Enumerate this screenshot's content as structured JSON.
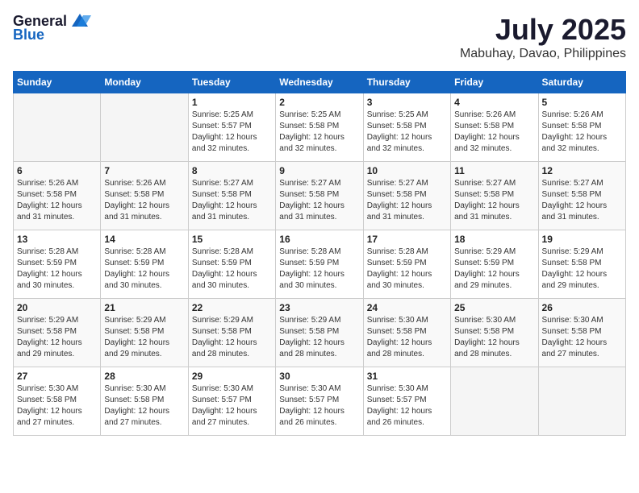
{
  "logo": {
    "text_general": "General",
    "text_blue": "Blue"
  },
  "header": {
    "month": "July 2025",
    "location": "Mabuhay, Davao, Philippines"
  },
  "weekdays": [
    "Sunday",
    "Monday",
    "Tuesday",
    "Wednesday",
    "Thursday",
    "Friday",
    "Saturday"
  ],
  "weeks": [
    [
      {
        "day": "",
        "info": ""
      },
      {
        "day": "",
        "info": ""
      },
      {
        "day": "1",
        "info": "Sunrise: 5:25 AM\nSunset: 5:57 PM\nDaylight: 12 hours\nand 32 minutes."
      },
      {
        "day": "2",
        "info": "Sunrise: 5:25 AM\nSunset: 5:58 PM\nDaylight: 12 hours\nand 32 minutes."
      },
      {
        "day": "3",
        "info": "Sunrise: 5:25 AM\nSunset: 5:58 PM\nDaylight: 12 hours\nand 32 minutes."
      },
      {
        "day": "4",
        "info": "Sunrise: 5:26 AM\nSunset: 5:58 PM\nDaylight: 12 hours\nand 32 minutes."
      },
      {
        "day": "5",
        "info": "Sunrise: 5:26 AM\nSunset: 5:58 PM\nDaylight: 12 hours\nand 32 minutes."
      }
    ],
    [
      {
        "day": "6",
        "info": "Sunrise: 5:26 AM\nSunset: 5:58 PM\nDaylight: 12 hours\nand 31 minutes."
      },
      {
        "day": "7",
        "info": "Sunrise: 5:26 AM\nSunset: 5:58 PM\nDaylight: 12 hours\nand 31 minutes."
      },
      {
        "day": "8",
        "info": "Sunrise: 5:27 AM\nSunset: 5:58 PM\nDaylight: 12 hours\nand 31 minutes."
      },
      {
        "day": "9",
        "info": "Sunrise: 5:27 AM\nSunset: 5:58 PM\nDaylight: 12 hours\nand 31 minutes."
      },
      {
        "day": "10",
        "info": "Sunrise: 5:27 AM\nSunset: 5:58 PM\nDaylight: 12 hours\nand 31 minutes."
      },
      {
        "day": "11",
        "info": "Sunrise: 5:27 AM\nSunset: 5:58 PM\nDaylight: 12 hours\nand 31 minutes."
      },
      {
        "day": "12",
        "info": "Sunrise: 5:27 AM\nSunset: 5:58 PM\nDaylight: 12 hours\nand 31 minutes."
      }
    ],
    [
      {
        "day": "13",
        "info": "Sunrise: 5:28 AM\nSunset: 5:59 PM\nDaylight: 12 hours\nand 30 minutes."
      },
      {
        "day": "14",
        "info": "Sunrise: 5:28 AM\nSunset: 5:59 PM\nDaylight: 12 hours\nand 30 minutes."
      },
      {
        "day": "15",
        "info": "Sunrise: 5:28 AM\nSunset: 5:59 PM\nDaylight: 12 hours\nand 30 minutes."
      },
      {
        "day": "16",
        "info": "Sunrise: 5:28 AM\nSunset: 5:59 PM\nDaylight: 12 hours\nand 30 minutes."
      },
      {
        "day": "17",
        "info": "Sunrise: 5:28 AM\nSunset: 5:59 PM\nDaylight: 12 hours\nand 30 minutes."
      },
      {
        "day": "18",
        "info": "Sunrise: 5:29 AM\nSunset: 5:59 PM\nDaylight: 12 hours\nand 29 minutes."
      },
      {
        "day": "19",
        "info": "Sunrise: 5:29 AM\nSunset: 5:58 PM\nDaylight: 12 hours\nand 29 minutes."
      }
    ],
    [
      {
        "day": "20",
        "info": "Sunrise: 5:29 AM\nSunset: 5:58 PM\nDaylight: 12 hours\nand 29 minutes."
      },
      {
        "day": "21",
        "info": "Sunrise: 5:29 AM\nSunset: 5:58 PM\nDaylight: 12 hours\nand 29 minutes."
      },
      {
        "day": "22",
        "info": "Sunrise: 5:29 AM\nSunset: 5:58 PM\nDaylight: 12 hours\nand 28 minutes."
      },
      {
        "day": "23",
        "info": "Sunrise: 5:29 AM\nSunset: 5:58 PM\nDaylight: 12 hours\nand 28 minutes."
      },
      {
        "day": "24",
        "info": "Sunrise: 5:30 AM\nSunset: 5:58 PM\nDaylight: 12 hours\nand 28 minutes."
      },
      {
        "day": "25",
        "info": "Sunrise: 5:30 AM\nSunset: 5:58 PM\nDaylight: 12 hours\nand 28 minutes."
      },
      {
        "day": "26",
        "info": "Sunrise: 5:30 AM\nSunset: 5:58 PM\nDaylight: 12 hours\nand 27 minutes."
      }
    ],
    [
      {
        "day": "27",
        "info": "Sunrise: 5:30 AM\nSunset: 5:58 PM\nDaylight: 12 hours\nand 27 minutes."
      },
      {
        "day": "28",
        "info": "Sunrise: 5:30 AM\nSunset: 5:58 PM\nDaylight: 12 hours\nand 27 minutes."
      },
      {
        "day": "29",
        "info": "Sunrise: 5:30 AM\nSunset: 5:57 PM\nDaylight: 12 hours\nand 27 minutes."
      },
      {
        "day": "30",
        "info": "Sunrise: 5:30 AM\nSunset: 5:57 PM\nDaylight: 12 hours\nand 26 minutes."
      },
      {
        "day": "31",
        "info": "Sunrise: 5:30 AM\nSunset: 5:57 PM\nDaylight: 12 hours\nand 26 minutes."
      },
      {
        "day": "",
        "info": ""
      },
      {
        "day": "",
        "info": ""
      }
    ]
  ]
}
